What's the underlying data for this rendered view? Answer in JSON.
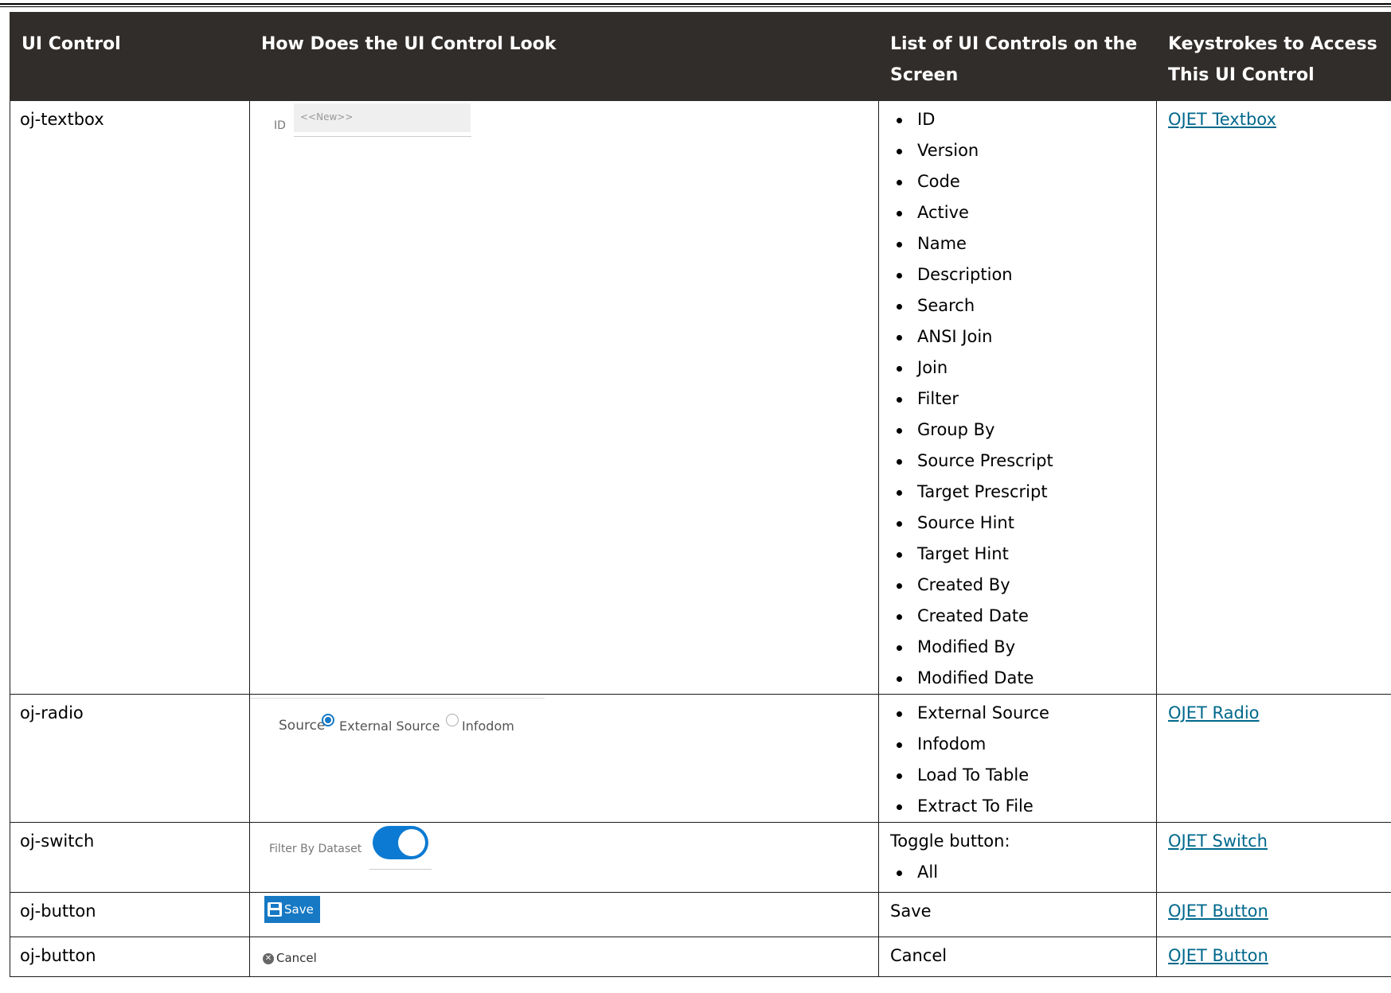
{
  "headers": [
    "UI Control",
    "How Does the UI Control Look",
    "List of UI Controls on the Screen",
    "Keystrokes to Access This UI Control"
  ],
  "rows": [
    {
      "control": "oj-textbox",
      "preview": {
        "label": "ID",
        "value": "<<New>>"
      },
      "list_intro": "",
      "items": [
        "ID",
        "Version",
        "Code",
        "Active",
        "Name",
        "Description",
        "Search",
        "ANSI Join",
        "Join",
        "Filter",
        "Group By",
        "Source Prescript",
        "Target Prescript",
        "Source Hint",
        "Target Hint",
        "Created By",
        "Created Date",
        "Modified By",
        "Modified Date"
      ],
      "link": "OJET Textbox"
    },
    {
      "control": "oj-radio",
      "preview": {
        "label": "Source",
        "option1": "External Source",
        "option2": "Infodom"
      },
      "list_intro": "",
      "items": [
        "External Source",
        "Infodom",
        "Load To Table",
        "Extract To File"
      ],
      "link": "OJET Radio"
    },
    {
      "control": "oj-switch",
      "preview": {
        "label": "Filter By Dataset"
      },
      "list_intro": "Toggle button:",
      "items": [
        "All"
      ],
      "link": "OJET Switch"
    },
    {
      "control": "oj-button",
      "preview": {
        "label": "Save"
      },
      "list_intro": "Save",
      "items": [],
      "link": "OJET Button"
    },
    {
      "control": "oj-button",
      "preview": {
        "label": "Cancel"
      },
      "list_intro": "Cancel",
      "items": [],
      "link": "OJET Button"
    }
  ],
  "colors": {
    "header_bg": "#312d2a",
    "link": "#00688c",
    "accent": "#1779c4"
  }
}
